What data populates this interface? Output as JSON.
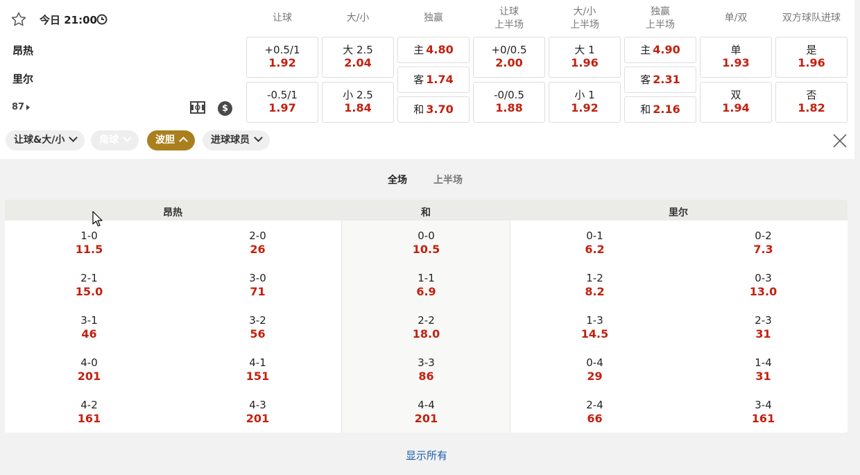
{
  "match": {
    "time": "今日 21:00",
    "home": "昂热",
    "away": "里尔",
    "minute": "87"
  },
  "column_headers": [
    {
      "l1": "让球",
      "l2": ""
    },
    {
      "l1": "大/小",
      "l2": ""
    },
    {
      "l1": "独赢",
      "l2": ""
    },
    {
      "l1": "让球",
      "l2": "上半场"
    },
    {
      "l1": "大/小",
      "l2": "上半场"
    },
    {
      "l1": "独赢",
      "l2": "上半场"
    },
    {
      "l1": "单/双",
      "l2": ""
    },
    {
      "l1": "双方球队进球",
      "l2": ""
    }
  ],
  "markets": {
    "handicap": [
      {
        "label": "+0.5/1",
        "odd": "1.92"
      },
      {
        "label": "-0.5/1",
        "odd": "1.97"
      }
    ],
    "total": [
      {
        "label": "大 2.5",
        "odd": "2.04"
      },
      {
        "label": "小 2.5",
        "odd": "1.84"
      }
    ],
    "moneyline": [
      {
        "label": "主",
        "odd": "4.80"
      },
      {
        "label": "客",
        "odd": "1.74"
      },
      {
        "label": "和",
        "odd": "3.70"
      }
    ],
    "handicap_1h": [
      {
        "label": "+0/0.5",
        "odd": "2.00"
      },
      {
        "label": "-0/0.5",
        "odd": "1.88"
      }
    ],
    "total_1h": [
      {
        "label": "大 1",
        "odd": "1.96"
      },
      {
        "label": "小 1",
        "odd": "1.92"
      }
    ],
    "moneyline_1h": [
      {
        "label": "主",
        "odd": "4.90"
      },
      {
        "label": "客",
        "odd": "2.31"
      },
      {
        "label": "和",
        "odd": "2.16"
      }
    ],
    "oddeven": [
      {
        "label": "单",
        "odd": "1.93"
      },
      {
        "label": "双",
        "odd": "1.94"
      }
    ],
    "btts": [
      {
        "label": "是",
        "odd": "1.96"
      },
      {
        "label": "否",
        "odd": "1.82"
      }
    ]
  },
  "filters": [
    "让球&大/小",
    "角球",
    "波胆",
    "进球球员"
  ],
  "period_tabs": [
    "全场",
    "上半场"
  ],
  "grid_headers": [
    "昂热",
    "和",
    "里尔"
  ],
  "correct_score": [
    [
      {
        "s": "1-0",
        "o": "11.5"
      },
      {
        "s": "2-0",
        "o": "26"
      },
      {
        "s": "0-0",
        "o": "10.5"
      },
      {
        "s": "0-1",
        "o": "6.2"
      },
      {
        "s": "0-2",
        "o": "7.3"
      }
    ],
    [
      {
        "s": "2-1",
        "o": "15.0"
      },
      {
        "s": "3-0",
        "o": "71"
      },
      {
        "s": "1-1",
        "o": "6.9"
      },
      {
        "s": "1-2",
        "o": "8.2"
      },
      {
        "s": "0-3",
        "o": "13.0"
      }
    ],
    [
      {
        "s": "3-1",
        "o": "46"
      },
      {
        "s": "3-2",
        "o": "56"
      },
      {
        "s": "2-2",
        "o": "18.0"
      },
      {
        "s": "1-3",
        "o": "14.5"
      },
      {
        "s": "2-3",
        "o": "31"
      }
    ],
    [
      {
        "s": "4-0",
        "o": "201"
      },
      {
        "s": "4-1",
        "o": "151"
      },
      {
        "s": "3-3",
        "o": "86"
      },
      {
        "s": "0-4",
        "o": "29"
      },
      {
        "s": "1-4",
        "o": "31"
      }
    ],
    [
      {
        "s": "4-2",
        "o": "161"
      },
      {
        "s": "4-3",
        "o": "201"
      },
      {
        "s": "4-4",
        "o": "201"
      },
      {
        "s": "2-4",
        "o": "66"
      },
      {
        "s": "3-4",
        "o": "161"
      }
    ]
  ],
  "show_all": "显示所有",
  "colors": {
    "odds": "#c3200f",
    "active_chip": "#a9801d",
    "link": "#1a5fa8"
  }
}
